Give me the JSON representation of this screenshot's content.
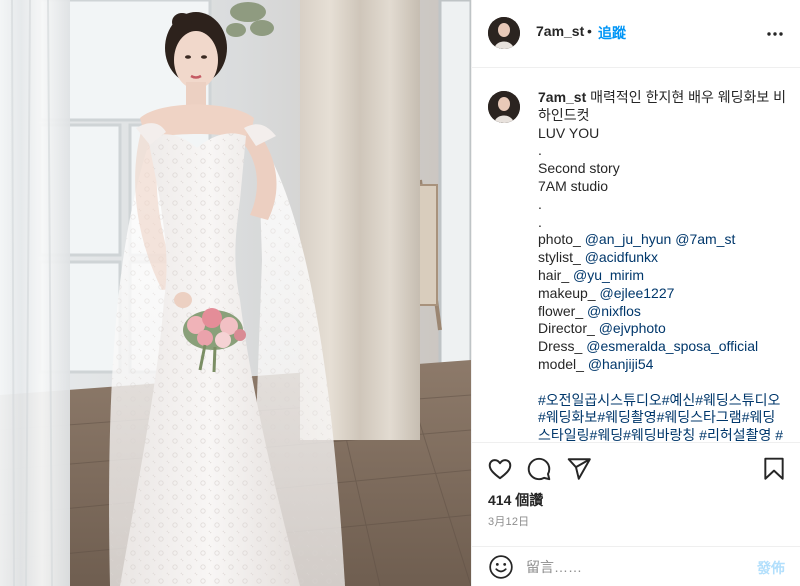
{
  "header": {
    "username": "7am_st",
    "separator": "•",
    "follow_label": "追蹤"
  },
  "caption": {
    "username": "7am_st",
    "intro": "매력적인 한지현 배우 웨딩화보 비하인드컷",
    "lines": {
      "l1": "LUV YOU",
      "l2": ".",
      "l3": "Second story",
      "l4": "7AM studio",
      "l5": ".",
      "l6": ".",
      "photo_label": "photo_ ",
      "photo_m1": "@an_ju_hyun",
      "photo_m2": "@7am_st",
      "stylist_label": "stylist_ ",
      "stylist_m": "@acidfunkx",
      "hair_label": "hair_ ",
      "hair_m": "@yu_mirim",
      "makeup_label": "makeup_ ",
      "makeup_m": "@ejlee1227",
      "flower_label": "flower_ ",
      "flower_m": "@nixflos",
      "director_label": "Director_ ",
      "director_m": "@ejvphoto",
      "dress_label": "Dress_ ",
      "dress_m": "@esmeralda_sposa_official",
      "model_label": "model_ ",
      "model_m": "@hanjiji54"
    },
    "hashtags": [
      "#오전일곱시스튜디오",
      "#예신",
      "#웨딩스튜디오",
      "#웨딩화보",
      "#웨딩촬영",
      "#웨딩스타그램",
      "#웨딩스타일링",
      "#웨딩",
      "#웨딩바랑칭",
      "#리허설촬영",
      "#스"
    ]
  },
  "stats": {
    "likes": "414 個讚",
    "date": "3月12日"
  },
  "comment": {
    "placeholder": "留言……",
    "post_label": "發佈"
  },
  "icons": {
    "more": "more-horizontal-icon",
    "like": "heart-icon",
    "comment": "comment-bubble-icon",
    "share": "paper-plane-icon",
    "save": "bookmark-icon",
    "emoji": "smiley-icon"
  },
  "colors": {
    "link_blue": "#0095f6",
    "mention_blue": "#00376b",
    "disabled_blue": "#b2dffc",
    "muted": "#8e8e8e",
    "text": "#262626",
    "border": "#efefef"
  }
}
